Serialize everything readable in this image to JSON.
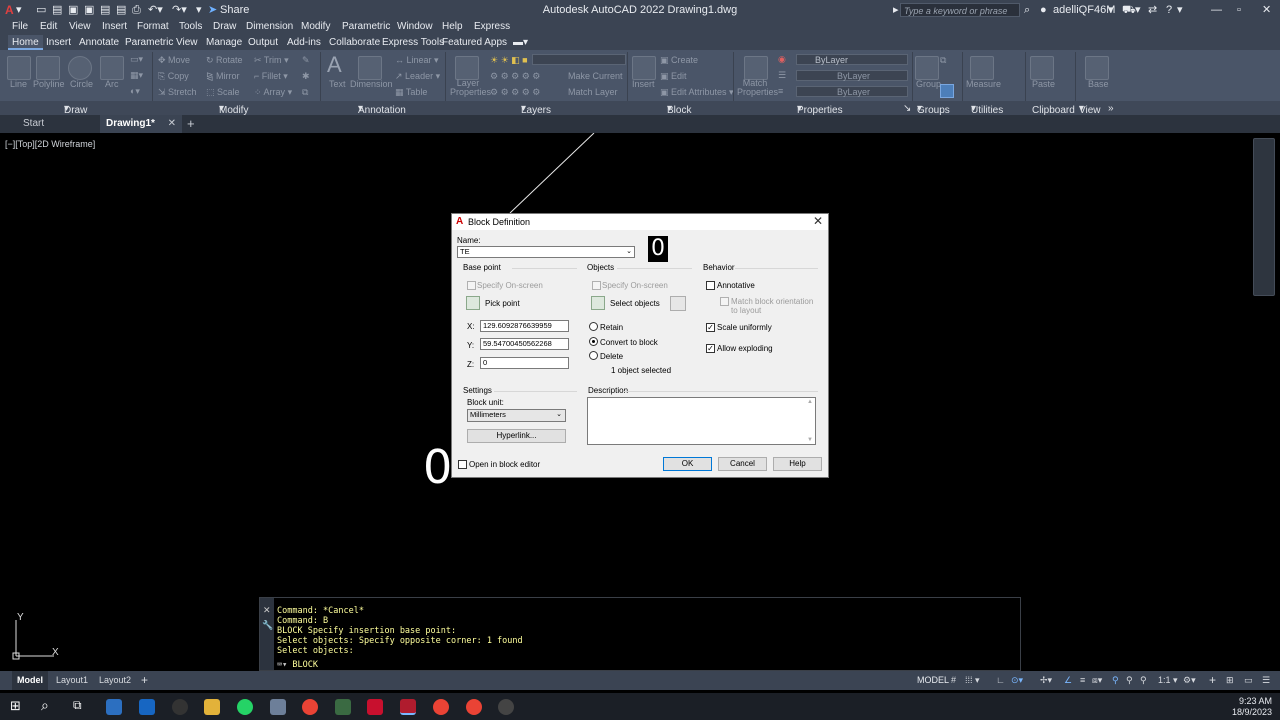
{
  "title_bar": {
    "title": "Autodesk AutoCAD 2022    Drawing1.dwg",
    "share_label": "Share",
    "search_placeholder": "Type a keyword or phrase",
    "user_label": "adelliQF46M"
  },
  "menu": [
    "File",
    "Edit",
    "View",
    "Insert",
    "Format",
    "Tools",
    "Draw",
    "Dimension",
    "Modify",
    "Parametric",
    "Window",
    "Help",
    "Express"
  ],
  "ribbon_tabs": [
    "Home",
    "Insert",
    "Annotate",
    "Parametric",
    "View",
    "Manage",
    "Output",
    "Add-ins",
    "Collaborate",
    "Express Tools",
    "Featured Apps"
  ],
  "ribbon": {
    "draw": {
      "line": "Line",
      "polyline": "Polyline",
      "circle": "Circle",
      "arc": "Arc"
    },
    "modify": {
      "move": "Move",
      "rotate": "Rotate",
      "trim": "Trim",
      "copy": "Copy",
      "mirror": "Mirror",
      "fillet": "Fillet",
      "stretch": "Stretch",
      "scale": "Scale",
      "array": "Array"
    },
    "annotation": {
      "text": "Text",
      "dimension": "Dimension",
      "linear": "Linear",
      "leader": "Leader",
      "table": "Table"
    },
    "layers": {
      "layer_properties": "Layer Properties",
      "make_current": "Make Current",
      "match_layer": "Match Layer"
    },
    "block": {
      "insert": "Insert",
      "create": "Create",
      "edit": "Edit",
      "edit_attributes": "Edit Attributes"
    },
    "properties": {
      "match_properties": "Match Properties",
      "bylayer1": "ByLayer",
      "bylayer2": "ByLayer",
      "bylayer3": "ByLayer"
    },
    "groups": {
      "group": "Group"
    },
    "utilities": {
      "measure": "Measure"
    },
    "clipboard": {
      "paste": "Paste"
    },
    "view": {
      "base": "Base"
    }
  },
  "panel_labels": [
    "Draw",
    "Modify",
    "Annotation",
    "Layers",
    "Block",
    "Properties",
    "Groups",
    "Utilities",
    "Clipboard",
    "View"
  ],
  "file_tabs": {
    "start": "Start",
    "drawing": "Drawing1*"
  },
  "viewport_label": "[−][Top][2D Wireframe]",
  "canvas": {
    "big_zero_1": "0",
    "big_zero_2": "0"
  },
  "dialog": {
    "title": "Block Definition",
    "name_label": "Name:",
    "name_value": "TE",
    "base_point": {
      "header": "Base point",
      "specify_on_screen": "Specify On-screen",
      "pick_point": "Pick point",
      "x_label": "X:",
      "x_value": "129.6092876639959",
      "y_label": "Y:",
      "y_value": "59.54700450562268",
      "z_label": "Z:",
      "z_value": "0"
    },
    "objects": {
      "header": "Objects",
      "specify_on_screen": "Specify On-screen",
      "select_objects": "Select objects",
      "retain": "Retain",
      "convert": "Convert to block",
      "delete": "Delete",
      "status": "1 object selected"
    },
    "behavior": {
      "header": "Behavior",
      "annotative": "Annotative",
      "match_orientation": "Match block orientation to layout",
      "scale_uniformly": "Scale uniformly",
      "allow_exploding": "Allow exploding"
    },
    "settings": {
      "header": "Settings",
      "block_unit_label": "Block unit:",
      "block_unit_value": "Millimeters",
      "hyperlink": "Hyperlink..."
    },
    "description_label": "Description",
    "open_in_editor": "Open in block editor",
    "ok": "OK",
    "cancel": "Cancel",
    "help": "Help"
  },
  "command_line": {
    "history": "Command: *Cancel*\nCommand: B\nBLOCK Specify insertion base point:\nSelect objects: Specify opposite corner: 1 found\nSelect objects:",
    "prompt": "BLOCK"
  },
  "ucs": {
    "y": "Y",
    "x": "X"
  },
  "status_bar": {
    "model_tab": "Model",
    "layout1": "Layout1",
    "layout2": "Layout2",
    "model_label": "MODEL",
    "scale": "1:1"
  },
  "taskbar": {
    "time": "9:23 AM",
    "date": "18/9/2023"
  },
  "colors": {
    "ribbon_bg": "#4a5568",
    "titlebar_bg": "#3b4453",
    "canvas_bg": "#000000",
    "command_text": "#ffff9c",
    "dialog_bg": "#f0f0f0"
  }
}
